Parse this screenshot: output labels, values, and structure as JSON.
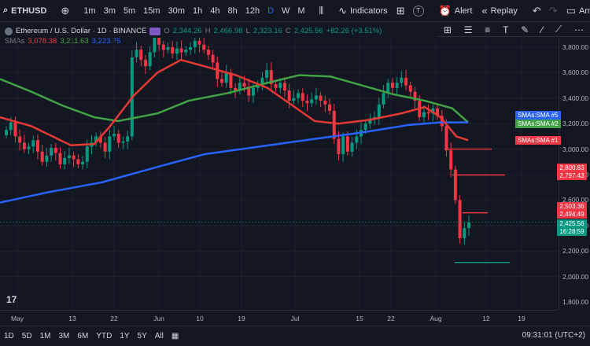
{
  "topbar": {
    "symbol": "ETHUSD",
    "timeframes": [
      "1m",
      "3m",
      "5m",
      "15m",
      "30m",
      "1h",
      "4h",
      "8h",
      "12h",
      "D",
      "W",
      "M"
    ],
    "active_timeframe": "D",
    "indicators_label": "Indicators",
    "alert_label": "Alert",
    "replay_label": "Replay",
    "right_label": "Am",
    "t_badge": "T"
  },
  "legend": {
    "title": "Ethereum / U.S. Dollar · 1D · BINANCE",
    "o_key": "O",
    "o_val": "2,344.26",
    "h_key": "H",
    "h_val": "2,466.98",
    "l_key": "L",
    "l_val": "2,323.16",
    "c_key": "C",
    "c_val": "2,425.56",
    "change": "+82.26 (+3.51%)",
    "sma_label": "SMAs",
    "sma_v1": "3,078.38",
    "sma_v2": "3,211.63",
    "sma_v3": "3,223.75"
  },
  "price_axis": [
    "3,800.00",
    "3,600.00",
    "3,400.00",
    "3,200.00",
    "3,000.00",
    "2,800.00",
    "2,600.00",
    "2,400.00",
    "2,200.00",
    "2,000.00",
    "1,800.00"
  ],
  "time_axis": [
    {
      "label": "May",
      "x": 22
    },
    {
      "label": "13",
      "x": 92
    },
    {
      "label": "22",
      "x": 145
    },
    {
      "label": "Jun",
      "x": 202
    },
    {
      "label": "10",
      "x": 254
    },
    {
      "label": "19",
      "x": 307
    },
    {
      "label": "Jul",
      "x": 375
    },
    {
      "label": "15",
      "x": 457
    },
    {
      "label": "22",
      "x": 497
    },
    {
      "label": "Aug",
      "x": 554
    },
    {
      "label": "12",
      "x": 618
    },
    {
      "label": "19",
      "x": 663
    }
  ],
  "price_tags": [
    {
      "text": "2,800.83",
      "color": "#f23645"
    },
    {
      "text": "2,797.43",
      "color": "#f23645"
    },
    {
      "text": "2,503.36",
      "color": "#f23645"
    },
    {
      "text": "2,494.49",
      "color": "#f23645"
    },
    {
      "text": "2,425.56",
      "color": "#089981"
    },
    {
      "text": "16:28:59",
      "color": "#089981"
    }
  ],
  "sma_tags": [
    {
      "text": "SMAs:SMA #5",
      "color": "#2962ff"
    },
    {
      "text": "SMAs:SMA #2",
      "color": "#43a047"
    },
    {
      "text": "SMAs:SMA #1",
      "color": "#f23645"
    }
  ],
  "bottombar": {
    "ranges": [
      "1D",
      "5D",
      "1M",
      "3M",
      "6M",
      "YTD",
      "1Y",
      "5Y",
      "All"
    ],
    "clock": "09:31:01 (UTC+2)"
  },
  "tv_logo": "17",
  "colors": {
    "up": "#089981",
    "down": "#f23645",
    "sma_red": "#e53935",
    "sma_green": "#43a047",
    "sma_blue": "#2962ff"
  },
  "chart_data": {
    "type": "candlestick",
    "title": "Ethereum / U.S. Dollar · 1D · BINANCE",
    "ylim": [
      1700,
      3900
    ],
    "note": "Daily OHLC candles with three SMAs (red SMA #1, green SMA #2, blue SMA #5)"
  }
}
